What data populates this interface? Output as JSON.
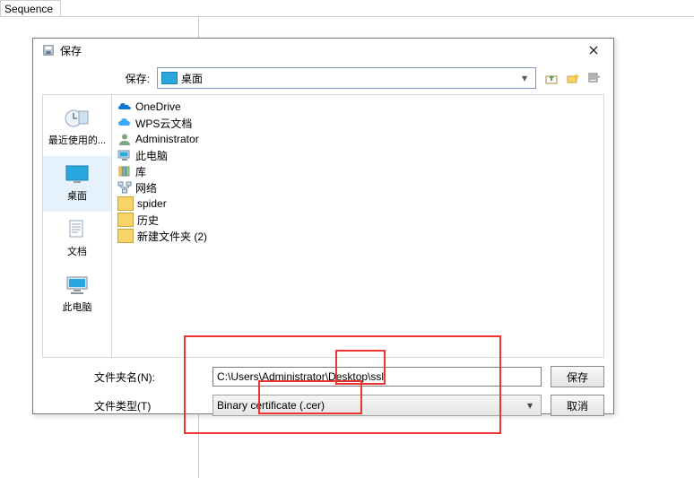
{
  "background": {
    "tab_label": "Sequence"
  },
  "dialog": {
    "title": "保存",
    "lookin_label": "保存:",
    "lookin_value": "桌面",
    "sidebar": {
      "items": [
        {
          "key": "recent",
          "label": "最近使用的..."
        },
        {
          "key": "desktop",
          "label": "桌面"
        },
        {
          "key": "documents",
          "label": "文档"
        },
        {
          "key": "thispc",
          "label": "此电脑"
        }
      ],
      "selected_index": 1
    },
    "files": [
      {
        "icon": "onedrive",
        "name": "OneDrive"
      },
      {
        "icon": "cloud",
        "name": "WPS云文档"
      },
      {
        "icon": "user",
        "name": "Administrator"
      },
      {
        "icon": "pc",
        "name": "此电脑"
      },
      {
        "icon": "libs",
        "name": "库"
      },
      {
        "icon": "network",
        "name": "网络"
      },
      {
        "icon": "folder",
        "name": "spider"
      },
      {
        "icon": "folder",
        "name": "历史"
      },
      {
        "icon": "folder",
        "name": "新建文件夹 (2)"
      }
    ],
    "filename_label": "文件夹名(N):",
    "filename_value": "C:\\Users\\Administrator\\Desktop\\ssl",
    "filetype_label": "文件类型(T)",
    "filetype_value": "Binary certificate (.cer)",
    "save_button": "保存",
    "cancel_button": "取消"
  }
}
